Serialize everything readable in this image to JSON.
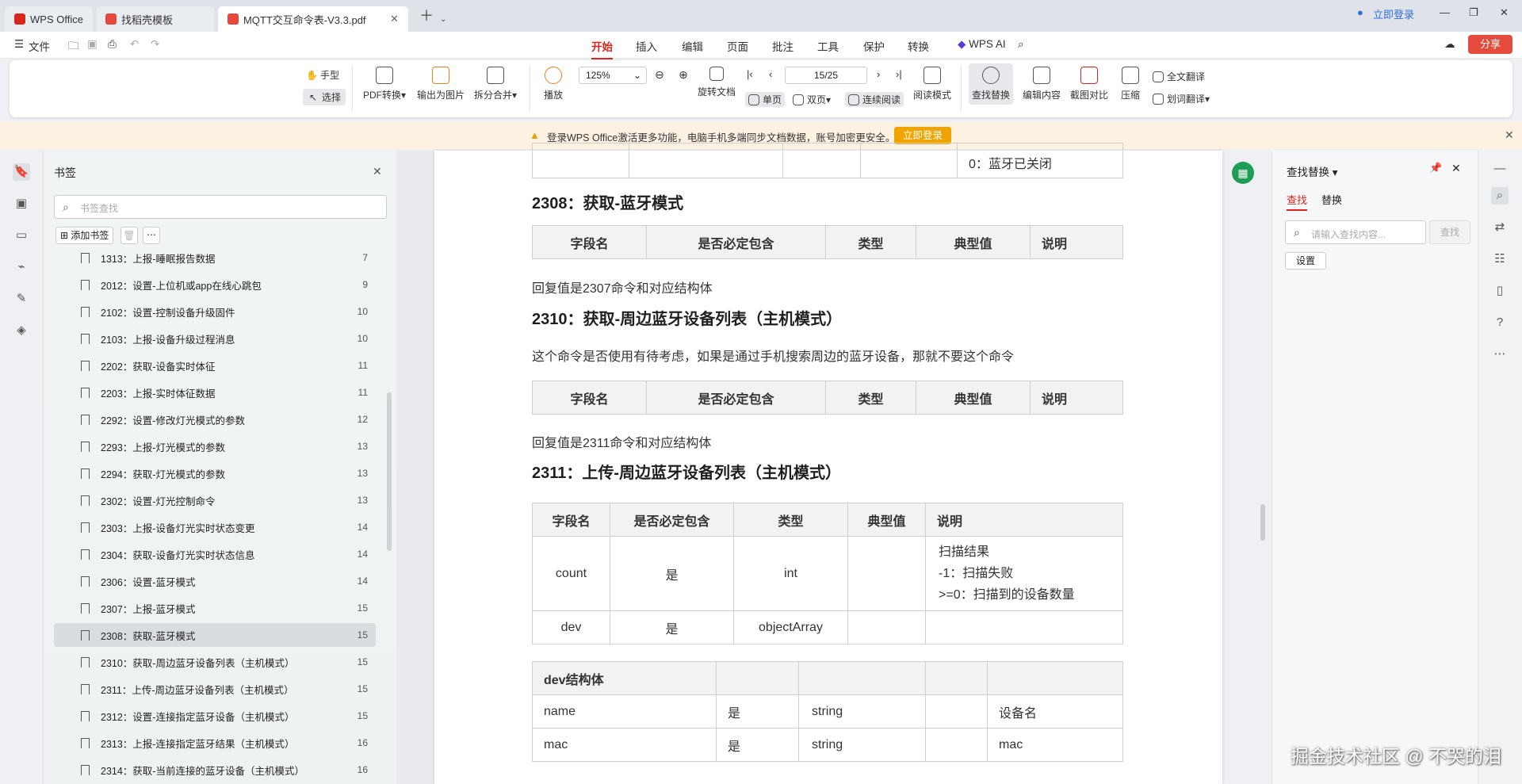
{
  "tabs": [
    {
      "label": "WPS Office",
      "active": false
    },
    {
      "label": "找稻壳模板",
      "active": false
    },
    {
      "label": "MQTT交互命令表-V3.3.pdf",
      "active": true
    }
  ],
  "titlebar": {
    "login": "立即登录"
  },
  "menubar": {
    "file": "文件",
    "items": [
      "开始",
      "插入",
      "编辑",
      "页面",
      "批注",
      "工具",
      "保护",
      "转换"
    ],
    "ai": "WPS AI",
    "share": "分享"
  },
  "ribbon": {
    "hand": "手型",
    "select": "选择",
    "pdf_convert": "PDF转换",
    "export_image": "输出为图片",
    "split_merge": "拆分合并",
    "play": "播放",
    "zoom": "125%",
    "page": "15/25",
    "rotate": "旋转文档",
    "single": "单页",
    "double": "双页",
    "continuous": "连续阅读",
    "read_mode": "阅读模式",
    "find_replace": "查找替换",
    "edit_content": "编辑内容",
    "crop_compare": "截图对比",
    "compress": "压缩",
    "full_translate": "全文翻译",
    "word_translate": "划词翻译"
  },
  "notice": {
    "text": "登录WPS Office激活更多功能，电脑手机多端同步文档数据，账号加密更安全。",
    "button": "立即登录"
  },
  "bookmarks": {
    "title": "书签",
    "search_placeholder": "书签查找",
    "add": "添加书签",
    "items": [
      {
        "label": "1313：上报-睡眠报告数据",
        "page": "7"
      },
      {
        "label": "2012：设置-上位机或app在线心跳包",
        "page": "9"
      },
      {
        "label": "2102：设置-控制设备升级固件",
        "page": "10"
      },
      {
        "label": "2103：上报-设备升级过程消息",
        "page": "10"
      },
      {
        "label": "2202：获取-设备实时体征",
        "page": "11"
      },
      {
        "label": "2203：上报-实时体征数据",
        "page": "11"
      },
      {
        "label": "2292：设置-修改灯光模式的参数",
        "page": "12"
      },
      {
        "label": "2293：上报-灯光模式的参数",
        "page": "13"
      },
      {
        "label": "2294：获取-灯光模式的参数",
        "page": "13"
      },
      {
        "label": "2302：设置-灯光控制命令",
        "page": "13"
      },
      {
        "label": "2303：上报-设备灯光实时状态变更",
        "page": "14"
      },
      {
        "label": "2304：获取-设备灯光实时状态信息",
        "page": "14"
      },
      {
        "label": "2306：设置-蓝牙模式",
        "page": "14"
      },
      {
        "label": "2307：上报-蓝牙模式",
        "page": "15"
      },
      {
        "label": "2308：获取-蓝牙模式",
        "page": "15"
      },
      {
        "label": "2310：获取-周边蓝牙设备列表（主机模式）",
        "page": "15"
      },
      {
        "label": "2311：上传-周边蓝牙设备列表（主机模式）",
        "page": "15"
      },
      {
        "label": "2312：设置-连接指定蓝牙设备（主机模式）",
        "page": "15"
      },
      {
        "label": "2313：上报-连接指定蓝牙结果（主机模式）",
        "page": "16"
      },
      {
        "label": "2314：获取-当前连接的蓝牙设备（主机模式）",
        "page": "16"
      }
    ]
  },
  "doc": {
    "top_cell": "0：蓝牙已关闭",
    "h2308": "2308：获取-蓝牙模式",
    "headers": [
      "字段名",
      "是否必定包含",
      "类型",
      "典型值",
      "说明"
    ],
    "reply2307": "回复值是2307命令和对应结构体",
    "h2310": "2310：获取-周边蓝牙设备列表（主机模式）",
    "note2310": "这个命令是否使用有待考虑，如果是通过手机搜索周边的蓝牙设备，那就不要这个命令",
    "reply2311": "回复值是2311命令和对应结构体",
    "h2311": "2311：上传-周边蓝牙设备列表（主机模式）",
    "t2311": [
      {
        "field": "count",
        "must": "是",
        "type": "int",
        "typical": "",
        "desc1": "扫描结果",
        "desc2": "-1：扫描失败",
        "desc3": ">=0：扫描到的设备数量"
      },
      {
        "field": "dev",
        "must": "是",
        "type": "objectArray",
        "typical": "",
        "desc1": ""
      }
    ],
    "dev_title": "dev结构体",
    "dev_rows": [
      {
        "field": "name",
        "must": "是",
        "type": "string",
        "typical": "",
        "desc": "设备名"
      },
      {
        "field": "mac",
        "must": "是",
        "type": "string",
        "typical": "",
        "desc": "mac"
      }
    ]
  },
  "find": {
    "title": "查找替换",
    "tab_find": "查找",
    "tab_replace": "替换",
    "placeholder": "请输入查找内容...",
    "button": "查找",
    "settings": "设置"
  },
  "watermark": "掘金技术社区 @ 不哭的泪"
}
